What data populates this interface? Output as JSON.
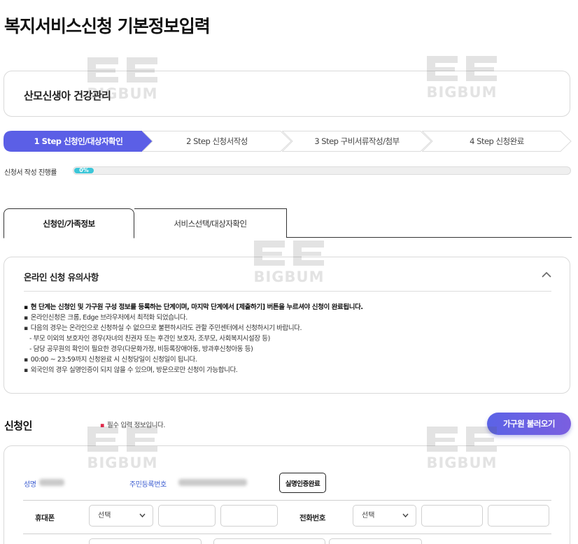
{
  "page_title": "복지서비스신청 기본정보입력",
  "service_name": "산모신생아 건강관리",
  "steps": [
    {
      "label": "1 Step 신청인/대상자확인",
      "active": true
    },
    {
      "label": "2 Step 신청서작성",
      "active": false
    },
    {
      "label": "3 Step 구비서류작성/첨부",
      "active": false
    },
    {
      "label": "4 Step 신청완료",
      "active": false
    }
  ],
  "progress": {
    "label": "신청서 작성 진행률",
    "value_text": "0%",
    "value": 0
  },
  "tabs": [
    {
      "label": "신청인/가족정보",
      "active": true
    },
    {
      "label": "서비스선택/대상자확인",
      "active": false
    }
  ],
  "notice": {
    "title": "온라인 신청 유의사항",
    "items": [
      "현 단계는 신청인 및 가구원 구성 정보를 등록하는 단계이며, 마지막 단계에서 [제출하기] 버튼을 누르셔야 신청이 완료됩니다.",
      "온라인신청은 크롬, Edge 브라우저에서 최적화 되었습니다.",
      "다음의 경우는 온라인으로 신청하실 수 없으므로 불편하시라도 관할 주민센터에서 신청하시기 바랍니다.",
      "- 부모 이외의 보호자인 경우(자녀의 친권자 또는 후견인 보호자, 조부모, 사회복지시설장 등)",
      "- 담당 공무원의 확인이 필요한 경우(다문화가정, 비등록장애아동, 방과후신청아동 등)",
      "00:00 ~ 23:59까지 신청완료 시 신청당일이 신청일이 됩니다.",
      "외국인의 경우 실명인증이 되지 않을 수 있으며, 방문으로만 신청이 가능합니다."
    ]
  },
  "applicant": {
    "section_title": "신청인",
    "required_note": "필수 입력 정보입니다.",
    "load_family_button": "가구원 불러오기",
    "name_label": "성명",
    "rrn_label": "주민등록번호",
    "verify_button": "실명인증완료",
    "mobile_label": "휴대폰",
    "mobile_select": "선택",
    "phone_label": "전화번호",
    "phone_select": "선택"
  },
  "watermark": "BIGBUM",
  "colors": {
    "accent": "#5b5fe6",
    "progress": "#3cc6d8",
    "label_blue": "#3a5bd0"
  },
  "icons": {
    "collapse": "chevron-up-icon",
    "dropdown": "chevron-down-icon"
  }
}
